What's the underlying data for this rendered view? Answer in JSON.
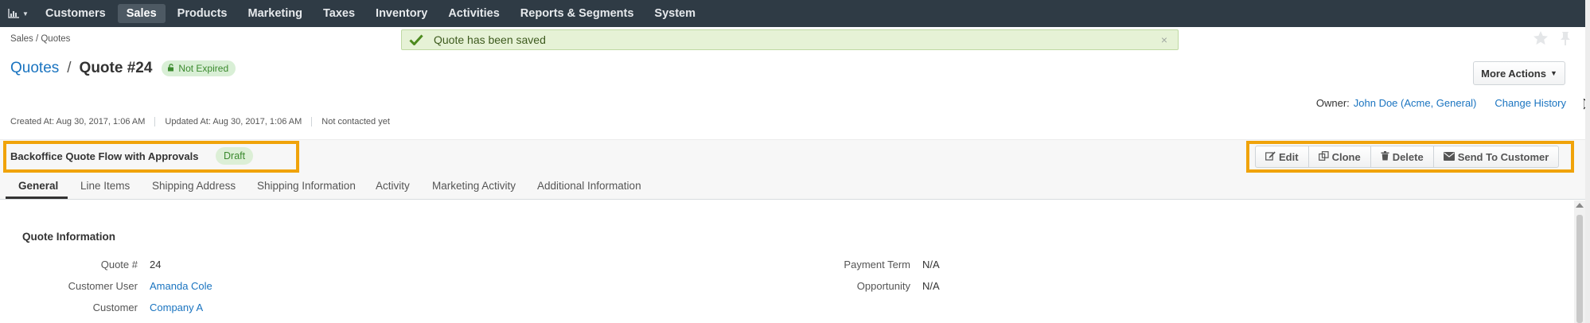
{
  "nav": {
    "logo_icon": "bar-chart-icon",
    "items": [
      {
        "label": "Customers"
      },
      {
        "label": "Sales"
      },
      {
        "label": "Products"
      },
      {
        "label": "Marketing"
      },
      {
        "label": "Taxes"
      },
      {
        "label": "Inventory"
      },
      {
        "label": "Activities"
      },
      {
        "label": "Reports & Segments"
      },
      {
        "label": "System"
      }
    ],
    "active": "Sales"
  },
  "breadcrumb": "Sales / Quotes",
  "flash": {
    "message": "Quote has been saved",
    "close": "×"
  },
  "header": {
    "parent_link": "Quotes",
    "separator": "/",
    "title": "Quote #24",
    "status": "Not Expired",
    "more_actions": "More Actions",
    "owner_label": "Owner:",
    "owner_value": "John Doe (Acme, General)",
    "change_history": "Change History"
  },
  "meta": {
    "created": "Created At: Aug 30, 2017, 1:06 AM",
    "updated": "Updated At: Aug 30, 2017, 1:06 AM",
    "contacted": "Not contacted yet"
  },
  "workflow": {
    "name": "Backoffice Quote Flow with Approvals",
    "step": "Draft"
  },
  "actions": {
    "edit": "Edit",
    "clone": "Clone",
    "delete": "Delete",
    "send": "Send To Customer"
  },
  "tabs": [
    {
      "label": "General"
    },
    {
      "label": "Line Items"
    },
    {
      "label": "Shipping Address"
    },
    {
      "label": "Shipping Information"
    },
    {
      "label": "Activity"
    },
    {
      "label": "Marketing Activity"
    },
    {
      "label": "Additional Information"
    }
  ],
  "section": {
    "title": "Quote Information",
    "left": [
      {
        "label": "Quote #",
        "value": "24"
      },
      {
        "label": "Customer User",
        "value": "Amanda Cole"
      },
      {
        "label": "Customer",
        "value": "Company A"
      }
    ],
    "right": [
      {
        "label": "Payment Term",
        "value": "N/A"
      },
      {
        "label": "Opportunity",
        "value": "N/A"
      }
    ]
  },
  "colors": {
    "nav_bg": "#2f3b45",
    "link": "#1a74c0",
    "highlight": "#f0a30a",
    "success_bg": "#e6f2d6",
    "badge_green": "#3b8a2e"
  }
}
